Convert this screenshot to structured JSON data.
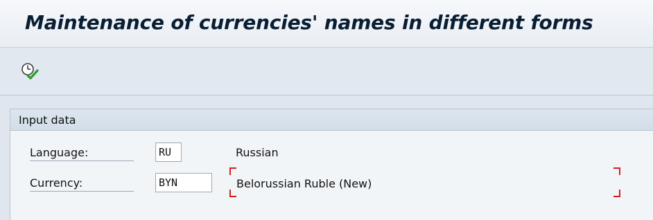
{
  "header": {
    "title": "Maintenance of currencies' names in different forms"
  },
  "toolbar": {
    "execute_icon": "execute-clock-check-icon"
  },
  "input_group": {
    "title": "Input data",
    "fields": [
      {
        "label": "Language:",
        "value": "RU",
        "description": "Russian"
      },
      {
        "label": "Currency:",
        "value": "BYN",
        "description": "Belorussian Ruble (New)"
      }
    ]
  },
  "colors": {
    "title_text": "#0a1e33",
    "required_marker": "#d0201e",
    "execute_icon_check": "#2f9e2f"
  }
}
